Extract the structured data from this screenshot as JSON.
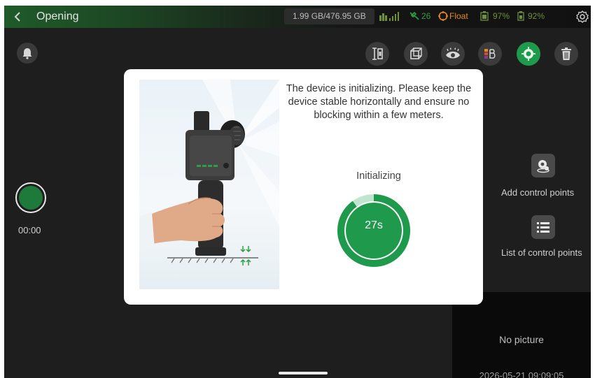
{
  "status_bar": {
    "title": "Opening",
    "storage": "1.99 GB/476.95 GB",
    "satellites": "26",
    "fix_status": "Float",
    "battery_1": "97%",
    "battery_2": "92%"
  },
  "left_panel": {
    "record_timer": "00:00"
  },
  "right_panel": {
    "add_control_points_label": "Add control points",
    "list_control_points_label": "List of control points",
    "no_picture_label": "No picture",
    "timestamp": "2026-05-21 09:09:05"
  },
  "modal": {
    "message": "The device is initializing. Please keep the device stable horizontally and ensure no blocking within a few meters.",
    "status_label": "Initializing",
    "countdown": "27s",
    "progress_fraction": 0.9
  },
  "colors": {
    "accent_green": "#1f9a4d",
    "progress_ring_track": "#bfe5cf",
    "progress_ring_fill": "#1f9a4d",
    "warning_orange": "#e58a1f"
  },
  "icons": {
    "back": "chevron-left-icon",
    "signal": "signal-icon",
    "satellite": "satellite-icon",
    "fix": "target-icon",
    "battery_device": "battery-icon",
    "battery_phone": "battery-icon",
    "settings": "gear-icon",
    "notifications": "bell-icon",
    "tool_1": "measure-icon",
    "tool_2": "cube-icon",
    "tool_3": "eye-icon",
    "tool_4": "layer-b-icon",
    "tool_5": "location-target-icon",
    "tool_6": "trash-icon"
  }
}
